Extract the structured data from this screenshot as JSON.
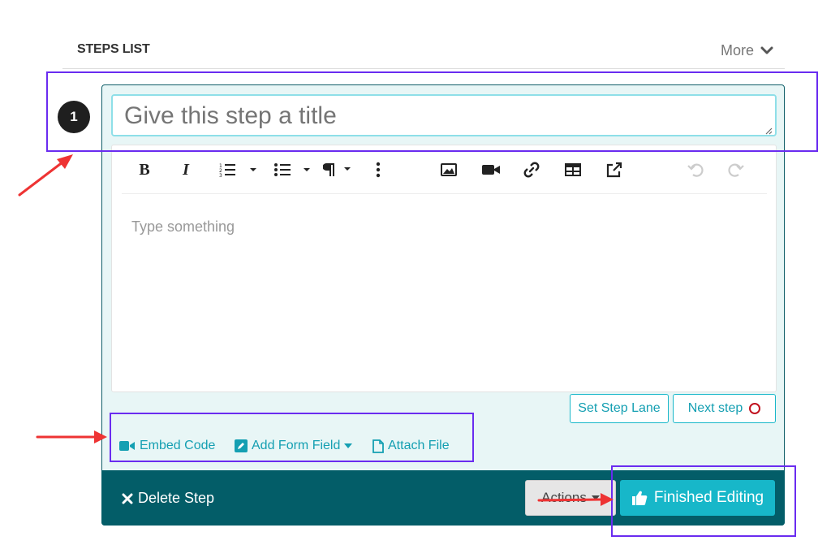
{
  "header": {
    "title": "STEPS LIST",
    "more_label": "More"
  },
  "step": {
    "number": "1",
    "title_placeholder": "Give this step a title",
    "editor_placeholder": "Type something"
  },
  "toolbar": {
    "bold": "B",
    "italic": "I",
    "icons": [
      "ordered-list-icon",
      "bullet-list-icon",
      "paragraph-icon",
      "more-vertical-icon",
      "image-icon",
      "video-icon",
      "link-icon",
      "table-icon",
      "external-link-icon",
      "undo-icon",
      "redo-icon"
    ]
  },
  "buttons": {
    "set_step_lane": "Set Step Lane",
    "next_step": "Next step",
    "embed_code": "Embed Code",
    "add_form_field": "Add Form Field",
    "attach_file": "Attach File",
    "delete_step": "Delete Step",
    "actions": "Actions",
    "finished_editing": "Finished Editing"
  },
  "colors": {
    "accent": "#17b7c9",
    "footer": "#035d68",
    "card_bg": "#e8f6f6",
    "annotation_box": "#6a2cf0",
    "annotation_arrow": "#ee3333",
    "next_step_ring": "#c1121f"
  }
}
